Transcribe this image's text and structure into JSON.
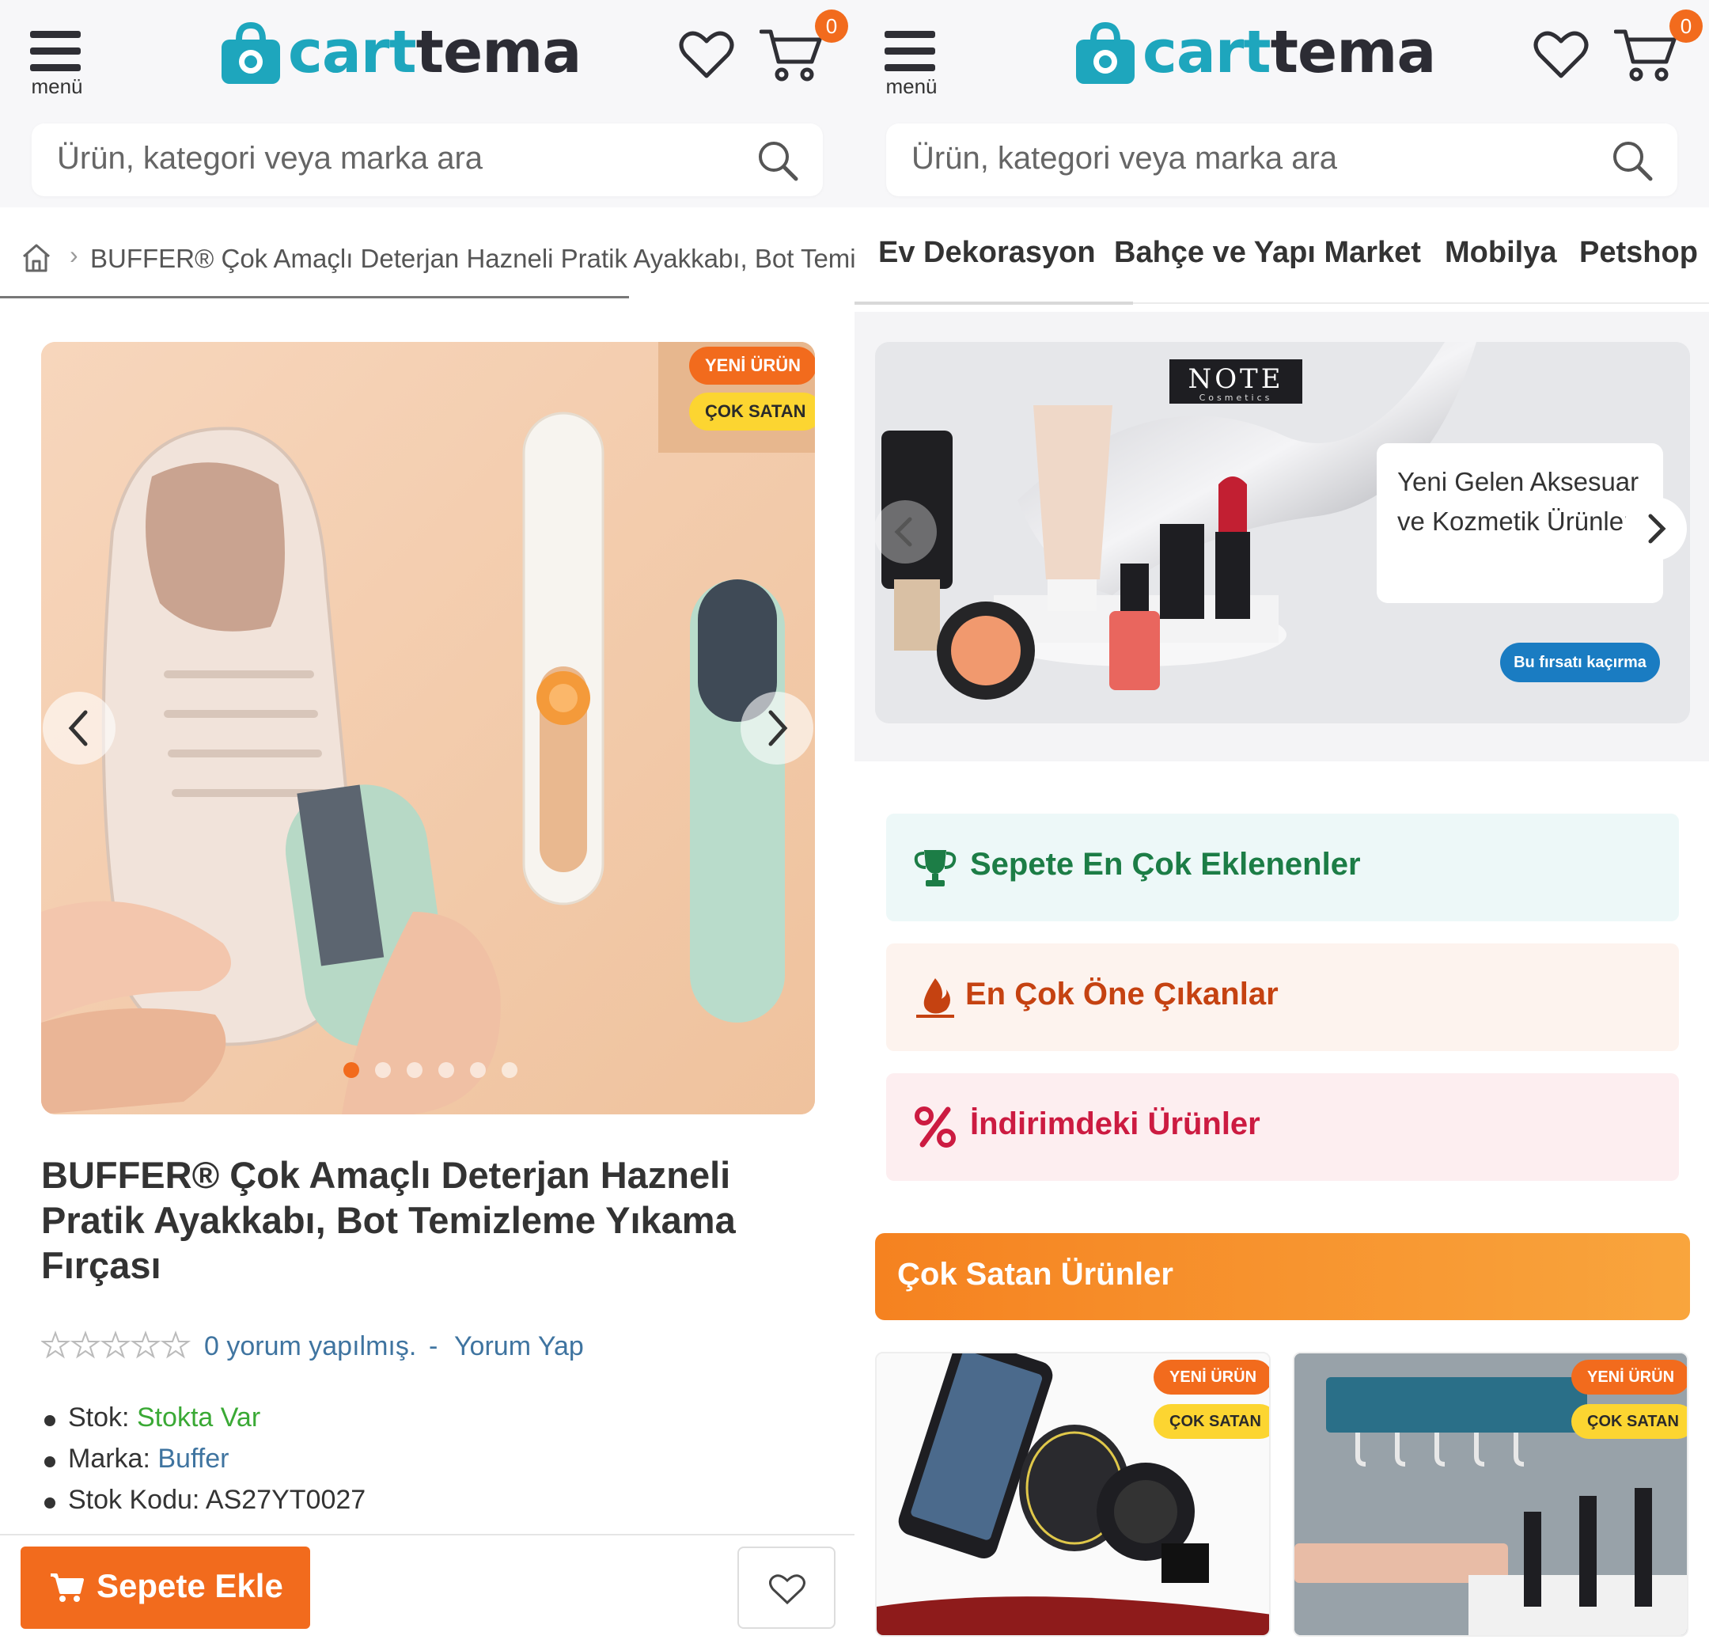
{
  "header": {
    "menu_label": "menü",
    "logo_text_part1": "cart",
    "logo_text_part2": "tema",
    "cart_count": "0"
  },
  "search": {
    "placeholder": "Ürün, kategori veya marka ara"
  },
  "colors": {
    "brand_teal": "#1ea6bd",
    "accent_orange": "#f26b1d",
    "badge_yellow": "#fcd531",
    "in_stock_green": "#3aa935",
    "link_blue": "#3f74a0"
  },
  "product_page": {
    "breadcrumb_home_icon": "home-icon",
    "breadcrumb_text": "BUFFER® Çok Amaçlı Deterjan Hazneli Pratik Ayakkabı, Bot Temizleme Yıkama Fırçası",
    "badges": {
      "new": "YENİ ÜRÜN",
      "bestseller": "ÇOK SATAN"
    },
    "image_count": 6,
    "active_image": 1,
    "title": "BUFFER® Çok Amaçlı Deterjan Hazneli Pratik Ayakkabı, Bot Temizleme Yıkama Fırçası",
    "rating": {
      "stars": 0,
      "max_stars": 5,
      "review_text": "0 yorum yapılmış.",
      "separator": "-",
      "write_review": "Yorum Yap"
    },
    "info": {
      "stock_label": "Stok:",
      "stock_value": "Stokta Var",
      "brand_label": "Marka:",
      "brand_value": "Buffer",
      "sku_label": "Stok Kodu:",
      "sku_value": "AS27YT0027"
    },
    "add_to_cart": "Sepete Ekle"
  },
  "home_page": {
    "categories": [
      "Ev Dekorasyon",
      "Bahçe ve Yapı Market",
      "Mobilya",
      "Petshop"
    ],
    "banner": {
      "brand_logo": "NOTE",
      "brand_sub": "Cosmetics",
      "headline": "Yeni Gelen Aksesuar ve Kozmetik Ürünleri",
      "cta": "Bu fırsatı kaçırma"
    },
    "features": [
      {
        "label": "Sepete En Çok Eklenenler",
        "icon": "trophy-icon"
      },
      {
        "label": "En Çok Öne Çıkanlar",
        "icon": "flame-icon"
      },
      {
        "label": "İndirimdeki Ürünler",
        "icon": "percent-icon"
      }
    ],
    "bestsellers_title": "Çok Satan Ürünler",
    "products": [
      {
        "badge_new": "YENİ ÜRÜN",
        "badge_hot": "ÇOK SATAN"
      },
      {
        "badge_new": "YENİ ÜRÜN",
        "badge_hot": "ÇOK SATAN"
      }
    ]
  }
}
